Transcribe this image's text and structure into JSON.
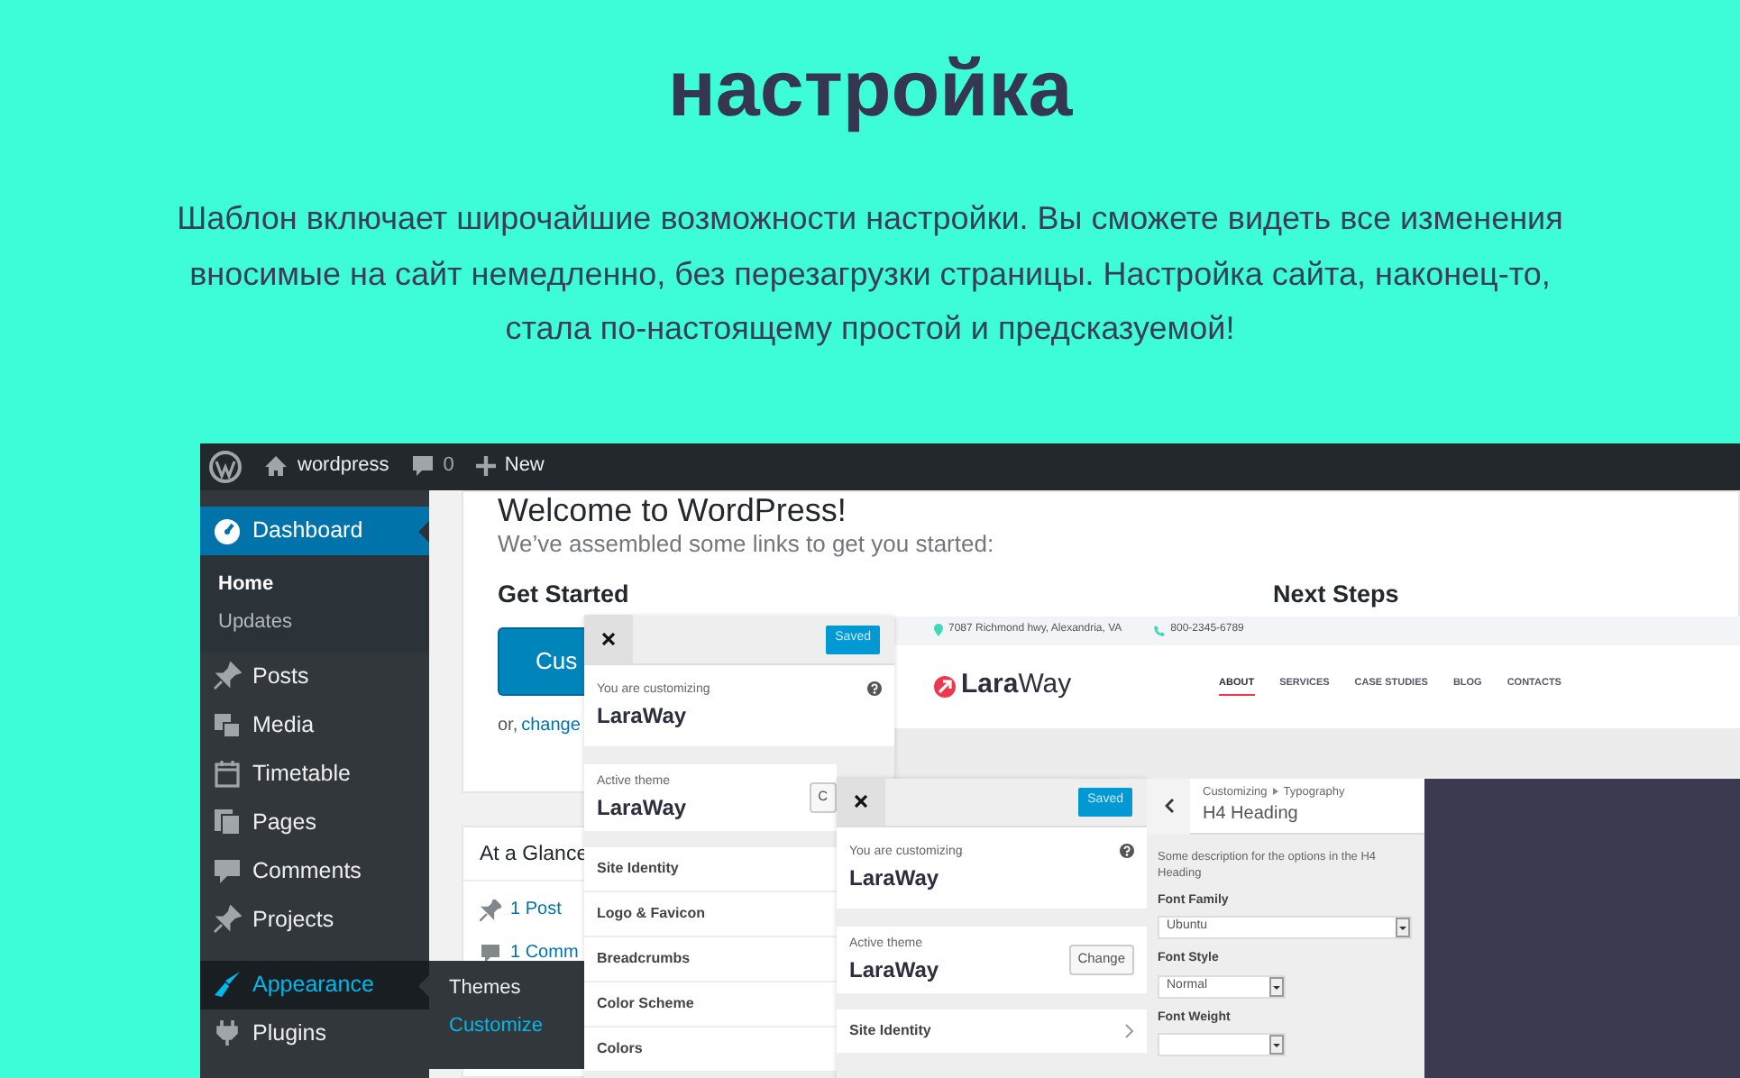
{
  "hero": {
    "title_lines": [
      "настройка"
    ],
    "description": "Шаблон включает широчайшие возможности настройки. Вы сможете видеть все изменения вносимые на сайт немедленно, без перезагрузки страницы. Настройка сайта, наконец-то, стала по-настоящему простой и предсказуемой!"
  },
  "admin_bar": {
    "site": "wordpress",
    "comments": "0",
    "new": "New"
  },
  "menu_groups": [
    [
      {
        "label": "Dashboard",
        "selected": true,
        "hovered": false,
        "submenu": [
          {
            "label": "Home",
            "selected": true
          },
          {
            "label": "Updates",
            "selected": false
          }
        ]
      },
      {
        "label": "Posts",
        "selected": false,
        "hovered": false
      },
      {
        "label": "Media",
        "selected": false,
        "hovered": false
      },
      {
        "label": "Timetable",
        "selected": false,
        "hovered": false
      },
      {
        "label": "Pages",
        "selected": false,
        "hovered": false
      },
      {
        "label": "Comments",
        "selected": false,
        "hovered": false
      },
      {
        "label": "Projects",
        "selected": false,
        "hovered": false
      }
    ],
    [
      {
        "label": "Appearance",
        "selected": false,
        "hovered": true,
        "flyout": [
          {
            "label": "Themes",
            "selected": false
          },
          {
            "label": "Customize",
            "selected": true
          }
        ]
      },
      {
        "label": "Plugins",
        "selected": false,
        "hovered": false
      }
    ]
  ],
  "welcome": {
    "title": "Welcome to WordPress!",
    "subtitle": "We’ve assembled some links to get you started:",
    "get_started": "Get Started",
    "button": "Cus",
    "link_prefix": "or,",
    "link": "change",
    "next_steps": "Next Steps"
  },
  "glance": {
    "title": "At a Glance",
    "items": [
      "1 Post",
      "1 Comm"
    ]
  },
  "customizer_panels": [
    {
      "saved": "Saved",
      "customizing_label": "You are customizing",
      "theme": "LaraWay",
      "active_label": "Active theme",
      "active_theme": "LaraWay",
      "change": "C",
      "sections": [
        {
          "label": "Site Identity",
          "chevron": false
        },
        {
          "label": "Logo & Favicon",
          "chevron": false
        },
        {
          "label": "Breadcrumbs",
          "chevron": false
        },
        {
          "label": "Color Scheme",
          "chevron": false
        },
        {
          "label": "Colors",
          "chevron": false
        }
      ]
    },
    {
      "saved": "Saved",
      "customizing_label": "You are customizing",
      "theme": "LaraWay",
      "active_label": "Active theme",
      "active_theme": "LaraWay",
      "change": "Change",
      "sections": [
        {
          "label": "Site Identity",
          "chevron": true
        }
      ]
    }
  ],
  "preview": {
    "address": "7087 Richmond hwy, Alexandria, VA",
    "phone": "800-2345-6789",
    "logo_bold": "Lara",
    "logo_light": "Way",
    "nav": [
      {
        "label": "ABOUT",
        "selected": true
      },
      {
        "label": "SERVICES",
        "selected": false
      },
      {
        "label": "CASE STUDIES",
        "selected": false
      },
      {
        "label": "BLOG",
        "selected": false
      },
      {
        "label": "CONTACTS",
        "selected": false
      }
    ]
  },
  "typography": {
    "breadcrumb_root": "Customizing",
    "breadcrumb_section": "Typography",
    "title": "H4 Heading",
    "description": "Some description for the options in the H4 Heading",
    "fields": [
      {
        "label": "Font Family",
        "value": "Ubuntu",
        "kind": "wide"
      },
      {
        "label": "Font Style",
        "value": "Normal",
        "kind": "narrow"
      },
      {
        "label": "Font Weight",
        "kind": "narrow"
      }
    ]
  }
}
